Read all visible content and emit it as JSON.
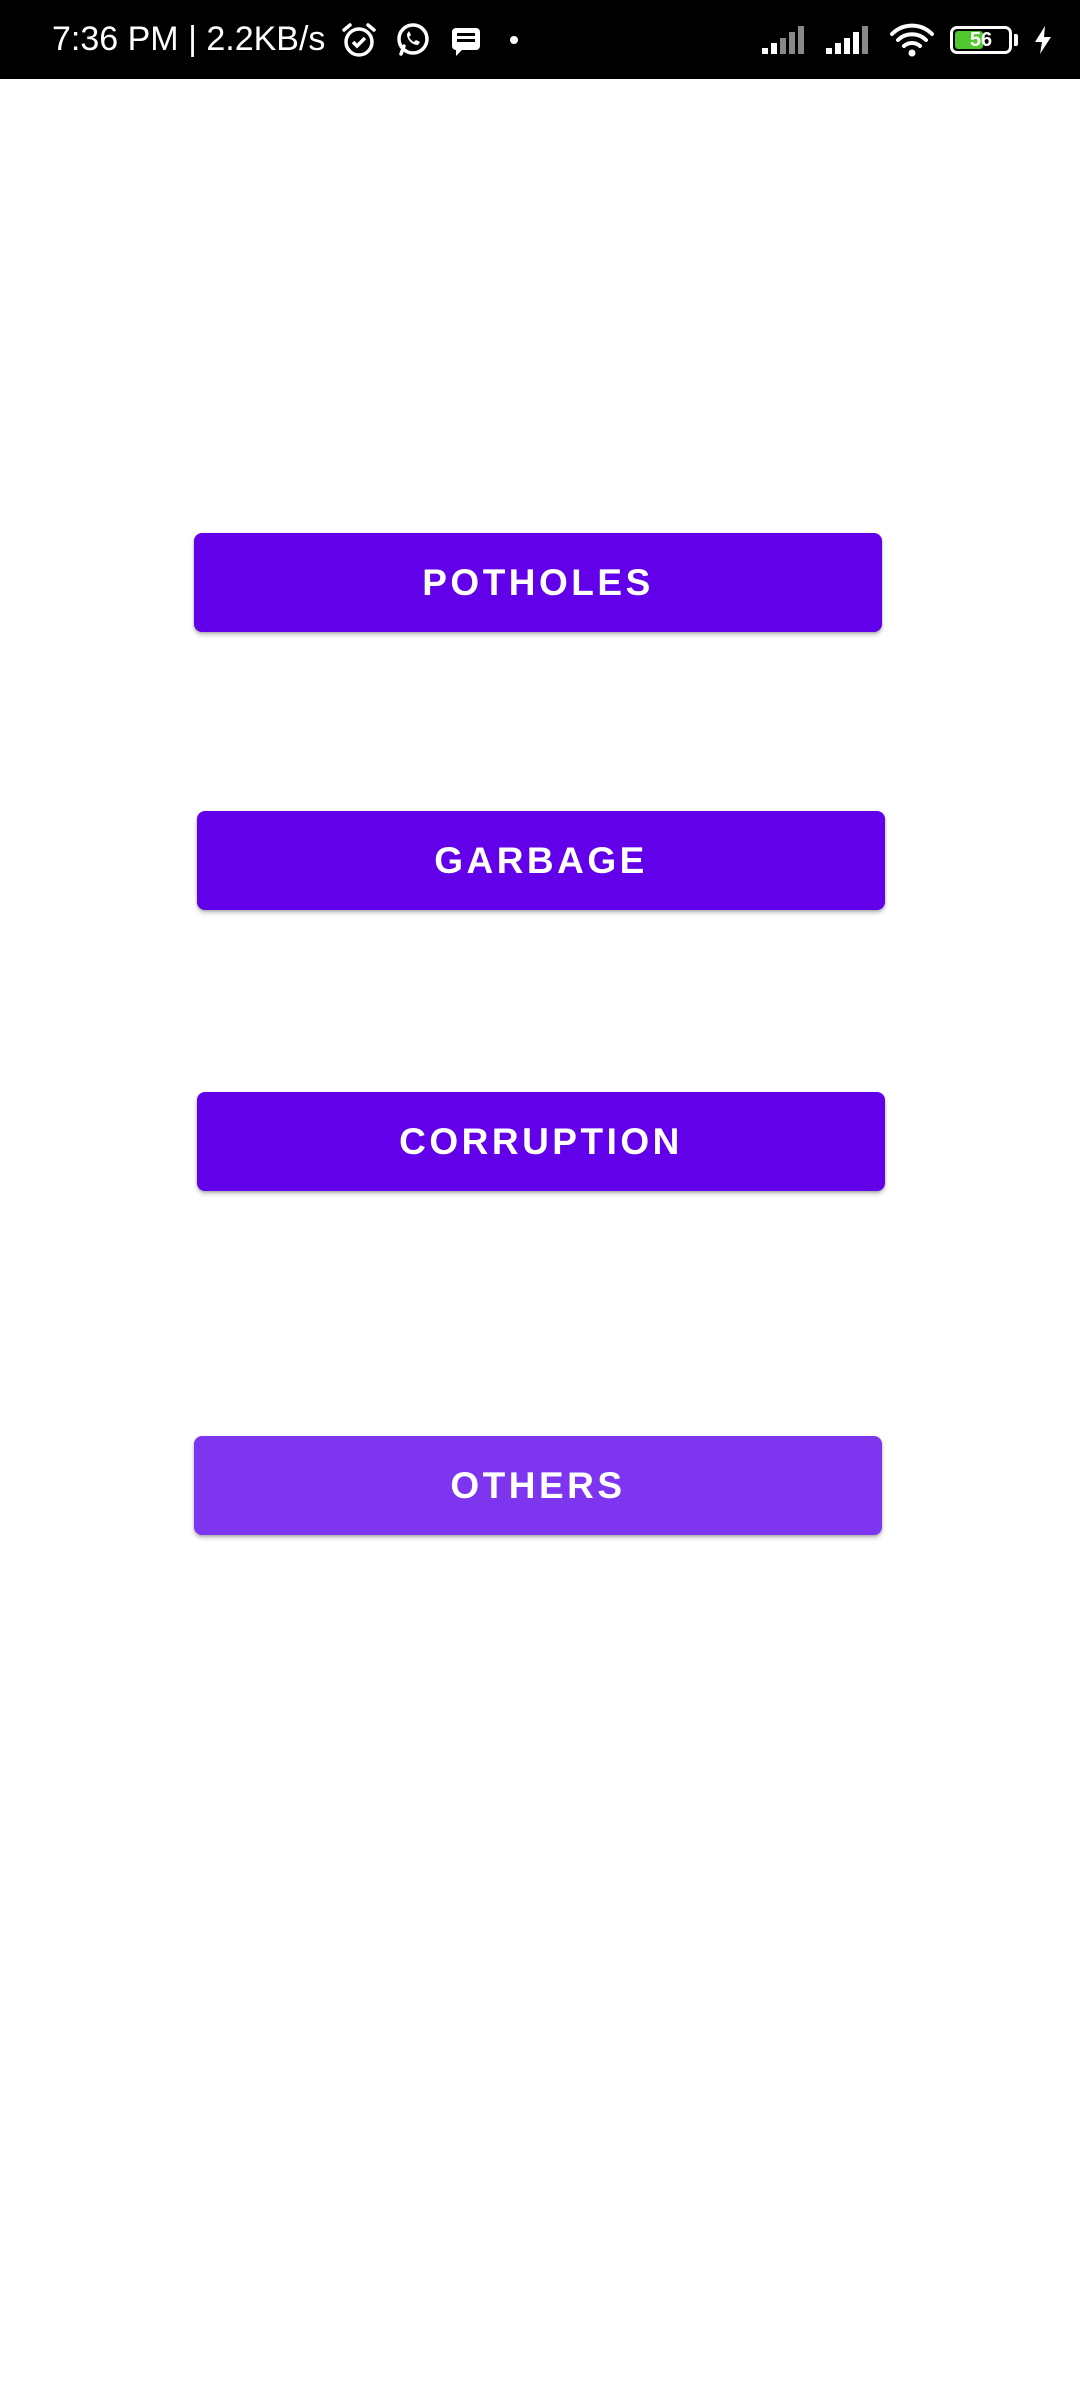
{
  "status_bar": {
    "time_and_speed": "7:36 PM | 2.2KB/s",
    "battery_level": "56",
    "battery_percent": 56,
    "icons_left": [
      "alarm-icon",
      "whatsapp-icon",
      "message-icon",
      "dot-icon"
    ],
    "icons_right": [
      "signal-icon",
      "signal-icon",
      "wifi-icon",
      "battery-icon",
      "charging-icon"
    ]
  },
  "buttons": {
    "potholes": {
      "label": "POTHOLES",
      "color": "#6200ea"
    },
    "garbage": {
      "label": "GARBAGE",
      "color": "#6200ea"
    },
    "corruption": {
      "label": "CORRUPTION",
      "color": "#6200ea"
    },
    "others": {
      "label": "OTHERS",
      "color": "#7e35f0"
    }
  }
}
